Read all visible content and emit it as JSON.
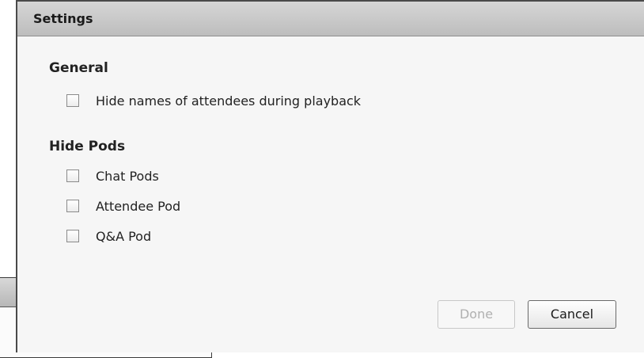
{
  "dialog": {
    "title": "Settings",
    "sections": [
      {
        "heading": "General",
        "options": [
          {
            "label": "Hide names of attendees during playback",
            "checked": false
          }
        ]
      },
      {
        "heading": "Hide Pods",
        "options": [
          {
            "label": "Chat Pods",
            "checked": false
          },
          {
            "label": "Attendee Pod",
            "checked": false
          },
          {
            "label": "Q&A Pod",
            "checked": false
          }
        ]
      }
    ],
    "buttons": {
      "done": "Done",
      "cancel": "Cancel"
    }
  }
}
